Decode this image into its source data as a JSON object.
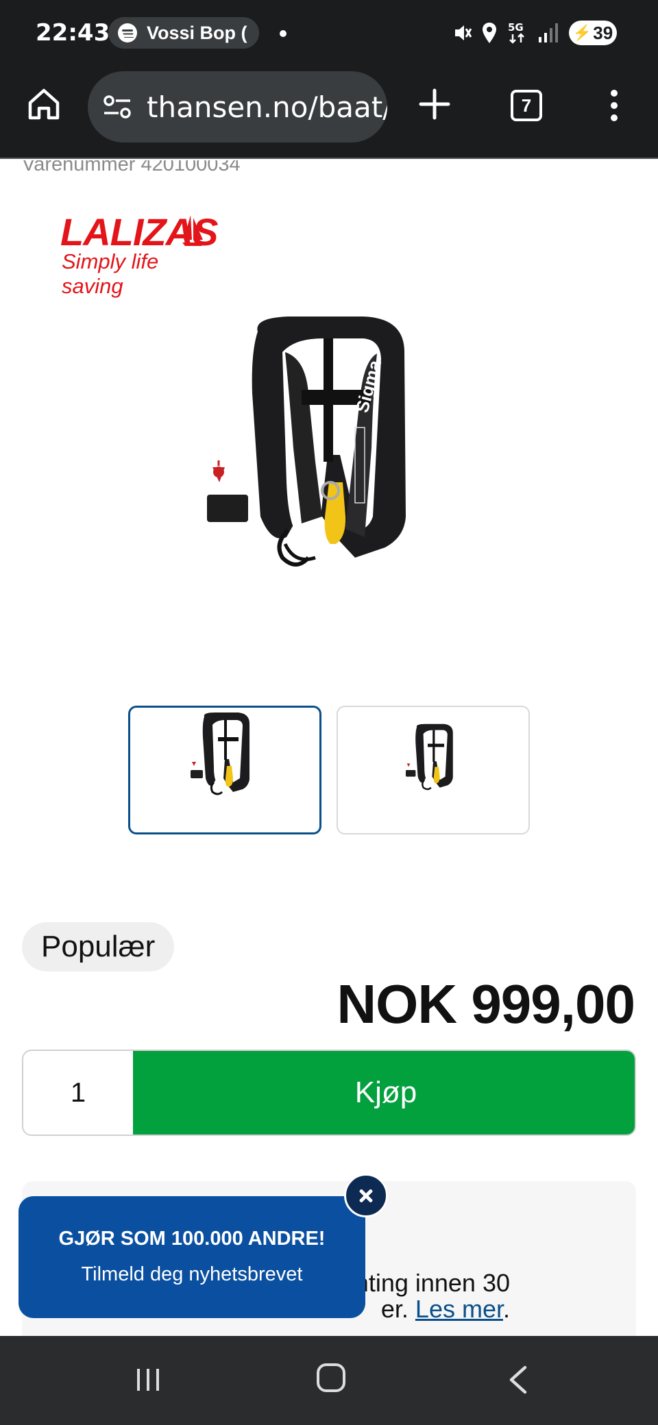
{
  "status_bar": {
    "time": "22:43",
    "media_app_icon": "spotify-icon",
    "media_text": "Vossi Bop (",
    "battery_level": "39",
    "icons": [
      "mute-icon",
      "location-icon",
      "5g-signal-icon",
      "signal-bars-icon",
      "battery-charging-icon"
    ]
  },
  "browser": {
    "url": "thansen.no/baat/",
    "tab_count": "7",
    "icons": [
      "home-icon",
      "site-settings-icon",
      "new-tab-icon",
      "tabs-icon",
      "menu-icon"
    ]
  },
  "product": {
    "article_number": "Varenummer 420100034",
    "brand": "LALIZAS",
    "brand_tagline": "Simply life saving",
    "vest_print": "Sigma",
    "badge": "Populær",
    "price": "NOK 999,00",
    "quantity": "1",
    "buy_label": "Kjøp",
    "thumbnail_count": 2
  },
  "info": {
    "line1": "enting innen 30",
    "line2_prefix": "er. ",
    "line2_link": "Les mer",
    "line2_suffix": "."
  },
  "newsletter_popup": {
    "title": "GJØR SOM 100.000 ANDRE!",
    "subtitle": "Tilmeld deg nyhetsbrevet"
  },
  "colors": {
    "accent_blue": "#0b4f8a",
    "buy_green": "#03a03e",
    "brand_red": "#e3151a",
    "popup_blue": "#0b50a0"
  }
}
